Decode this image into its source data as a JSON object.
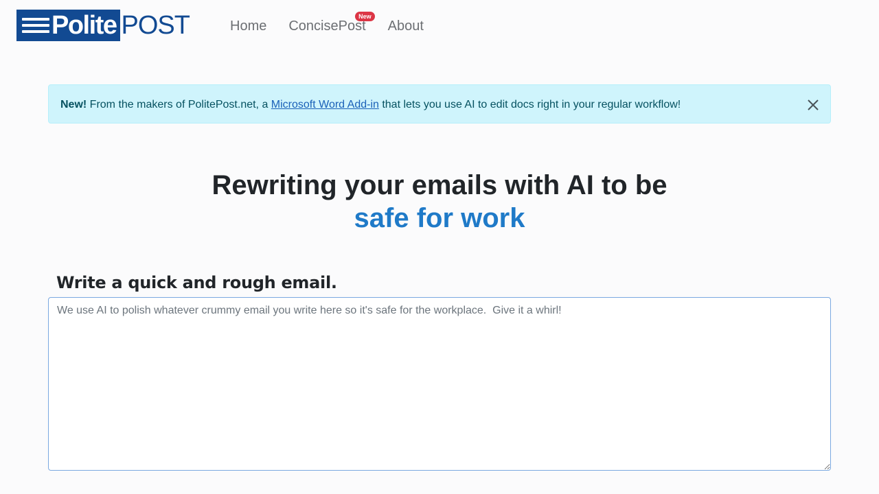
{
  "logo": {
    "polite": "Polite",
    "post": "POST"
  },
  "nav": [
    {
      "label": "Home"
    },
    {
      "label": "ConcisePost",
      "badge": "New"
    },
    {
      "label": "About"
    }
  ],
  "alert": {
    "strong": "New!",
    "text_before": " From the makers of PolitePost.net, a ",
    "link": "Microsoft Word Add-in",
    "text_after": " that lets you use AI to edit docs right in your regular workflow!"
  },
  "headline": {
    "line1": "Rewriting your emails with AI to be",
    "accent": "safe for work"
  },
  "email": {
    "label": "Write a quick and rough email.",
    "placeholder": "We use AI to polish whatever crummy email you write here so it's safe for the workplace.  Give it a whirl!"
  },
  "colors": {
    "brand": "#124a92",
    "accent": "#1f7ac8",
    "alert_bg": "#cff4fc",
    "badge": "#dc3545"
  },
  "icons": {
    "close": "close-icon",
    "logo_lines": "three-lines-icon"
  }
}
